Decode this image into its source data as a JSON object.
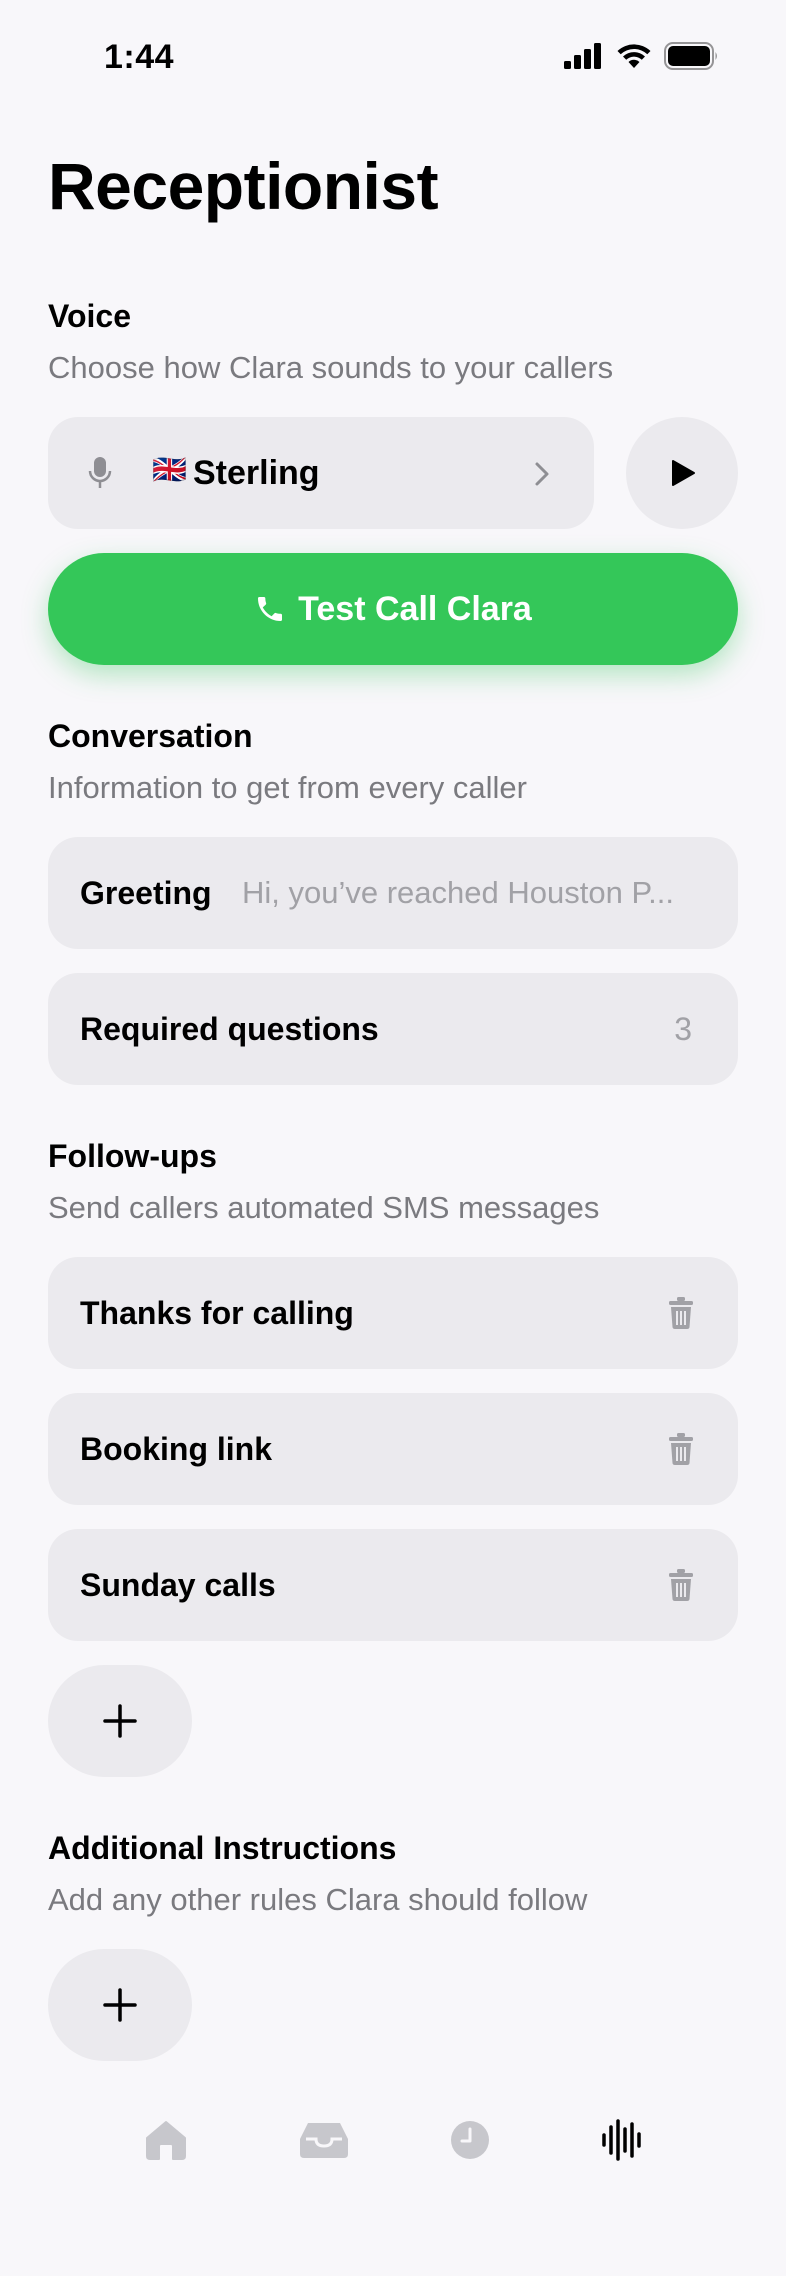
{
  "status_bar": {
    "time": "1:44"
  },
  "page": {
    "title": "Receptionist"
  },
  "voice_section": {
    "title": "Voice",
    "subtitle": "Choose how Clara sounds to your callers",
    "voice": {
      "flag": "🇬🇧",
      "name": "Sterling"
    }
  },
  "test_call": {
    "label": "Test Call Clara"
  },
  "conversation_section": {
    "title": "Conversation",
    "subtitle": "Information to get from every caller",
    "greeting": {
      "label": "Greeting",
      "value": "Hi, you’ve reached Houston P..."
    },
    "required_questions": {
      "label": "Required questions",
      "count": "3"
    }
  },
  "followups_section": {
    "title": "Follow-ups",
    "subtitle": "Send callers automated SMS messages",
    "items": [
      {
        "label": "Thanks for calling"
      },
      {
        "label": "Booking link"
      },
      {
        "label": "Sunday calls"
      }
    ]
  },
  "instructions_section": {
    "title": "Additional Instructions",
    "subtitle": "Add any other rules Clara should follow"
  },
  "tab_bar": {
    "tabs": [
      {
        "icon": "home-icon",
        "active": false
      },
      {
        "icon": "inbox-icon",
        "active": false
      },
      {
        "icon": "clock-icon",
        "active": false
      },
      {
        "icon": "waveform-icon",
        "active": true
      }
    ]
  },
  "colors": {
    "accent_green": "#34c759",
    "card_bg": "#ebeaee",
    "page_bg": "#f8f7fa",
    "secondary_text": "#7a7a7f"
  }
}
